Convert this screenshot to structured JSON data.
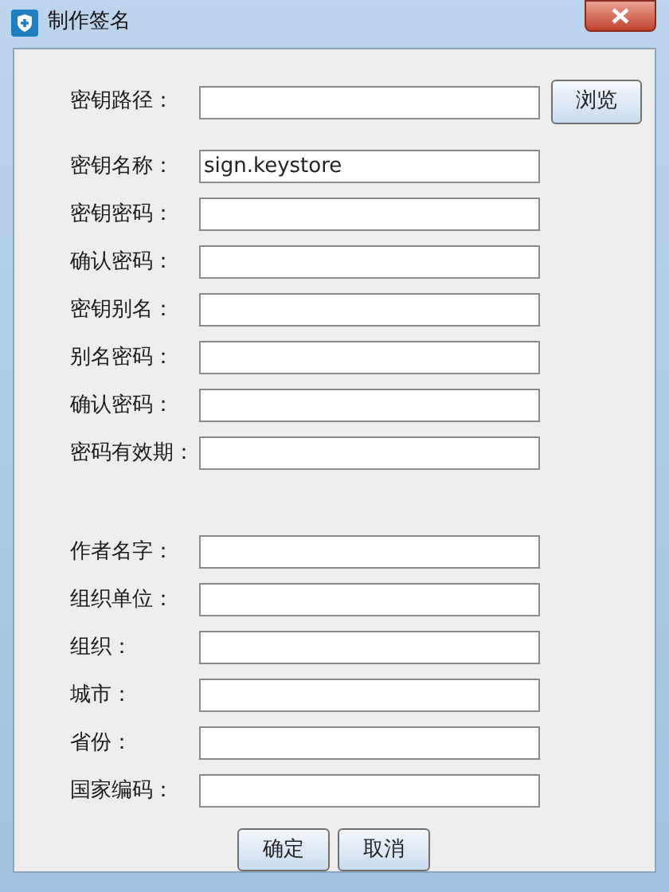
{
  "window": {
    "title": "制作签名"
  },
  "key_fields": [
    {
      "label": "密钥路径：",
      "button": "浏览"
    },
    {
      "label": "密钥名称：",
      "value": "sign.keystore"
    },
    {
      "label": "密钥密码："
    },
    {
      "label": "确认密码："
    },
    {
      "label": "密钥别名："
    },
    {
      "label": "别名密码："
    },
    {
      "label": "确认密码："
    },
    {
      "label": "密码有效期："
    }
  ],
  "author_fields": [
    {
      "label": "作者名字："
    },
    {
      "label": "组织单位："
    },
    {
      "label": "组织："
    },
    {
      "label": "城市："
    },
    {
      "label": "省份："
    },
    {
      "label": "国家编码："
    }
  ],
  "buttons": [
    "确定",
    "取消"
  ]
}
